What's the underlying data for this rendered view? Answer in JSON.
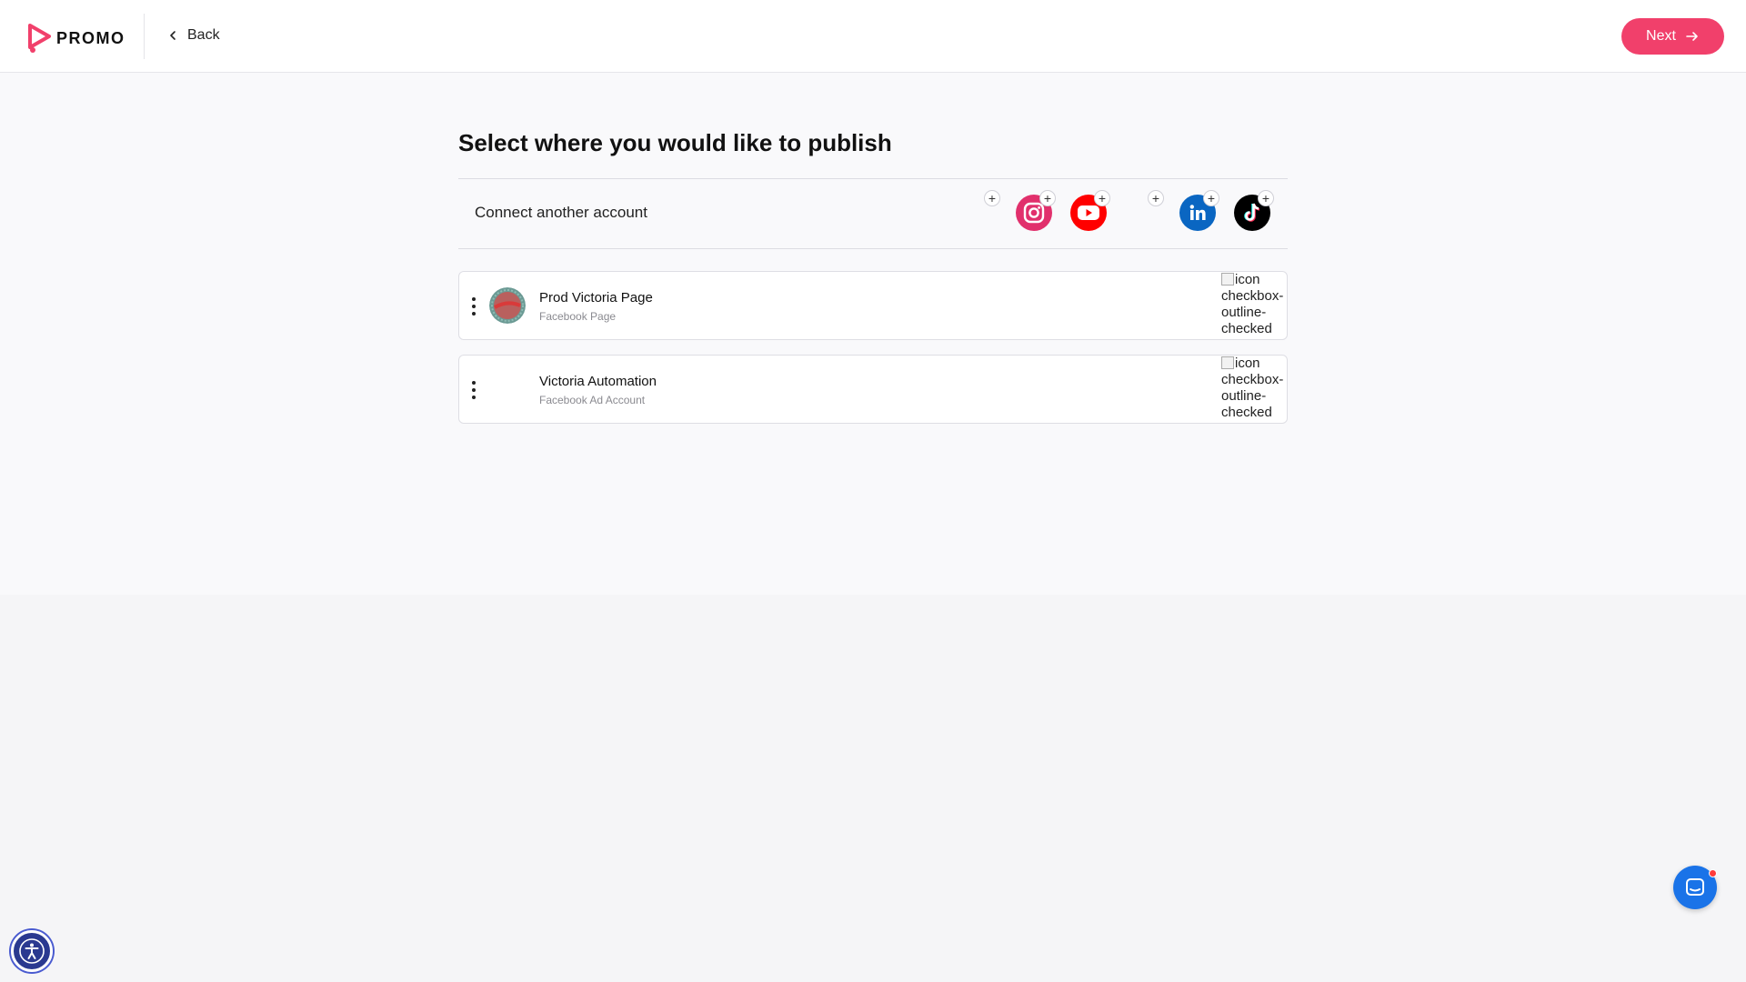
{
  "brand": {
    "name": "PROMO",
    "accent": "#f1406b"
  },
  "header": {
    "back_label": "Back",
    "next_label": "Next"
  },
  "main": {
    "title": "Select where you would like to publish",
    "connect_label": "Connect another account",
    "social_networks": [
      {
        "name": "facebook-icon",
        "visible": false
      },
      {
        "name": "instagram-icon",
        "color": "#e1306c"
      },
      {
        "name": "youtube-icon",
        "color": "#ff0000"
      },
      {
        "name": "twitter-icon",
        "visible": false
      },
      {
        "name": "linkedin-icon",
        "color": "#0a66c2"
      },
      {
        "name": "tiktok-icon",
        "color": "#000000"
      }
    ],
    "plus_symbol": "+",
    "accounts": [
      {
        "name": "Prod Victoria Page",
        "type": "Facebook Page",
        "checkbox_alt": "icon checkbox-outline-checked",
        "has_avatar": true
      },
      {
        "name": "Victoria Automation",
        "type": "Facebook Ad Account",
        "checkbox_alt": "icon checkbox-outline-checked",
        "has_avatar": false
      }
    ]
  },
  "widgets": {
    "chat_color": "#1a73e8",
    "accessibility_color": "#2a3990"
  }
}
